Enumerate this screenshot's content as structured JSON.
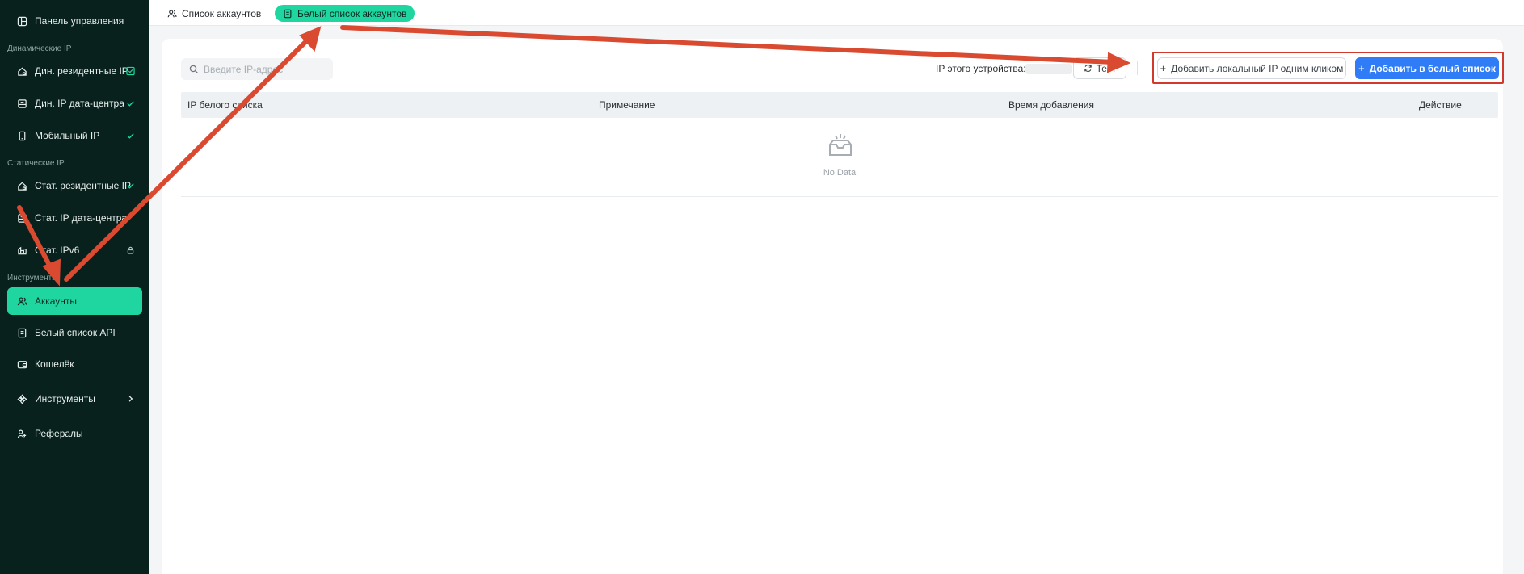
{
  "sidebar": {
    "items": [
      {
        "label": "Панель управления",
        "icon": "dashboard-icon"
      },
      {
        "label": "Дин. резидентные IP",
        "icon": "home-wifi-icon",
        "trail": "checkbox-check-icon"
      },
      {
        "label": "Дин. IP дата-центра",
        "icon": "datacenter-icon",
        "trail": "check-icon"
      },
      {
        "label": "Мобильный IP",
        "icon": "phone-icon",
        "trail": "check-icon"
      },
      {
        "label": "Стат. резидентные IP",
        "icon": "home-icon",
        "trail": "check-icon"
      },
      {
        "label": "Стат. IP дата-центра",
        "icon": "server-icon"
      },
      {
        "label": "Стат. IPv6",
        "icon": "ipv6-icon",
        "trail": "lock-icon"
      },
      {
        "label": "Аккаунты",
        "icon": "users-icon",
        "active": true
      },
      {
        "label": "Белый список API",
        "icon": "document-icon"
      },
      {
        "label": "Кошелёк",
        "icon": "wallet-icon"
      },
      {
        "label": "Инструменты",
        "icon": "tools-icon",
        "trail": "chevron-right-icon"
      },
      {
        "label": "Рефералы",
        "icon": "referral-icon"
      }
    ],
    "sections": {
      "dynamic": "Динамические IP",
      "static": "Статические IP",
      "tools": "Инструменты"
    }
  },
  "tabs": [
    {
      "label": "Список аккаунтов",
      "icon": "users-icon"
    },
    {
      "label": "Белый список аккаунтов",
      "icon": "document-icon",
      "active": true
    }
  ],
  "search": {
    "placeholder": "Введите IP-адрес"
  },
  "device_ip": {
    "label": "IP этого устройства:"
  },
  "buttons": {
    "test": "Тест",
    "add_local": "Добавить локальный IP одним кликом",
    "add_whitelist": "Добавить в белый список"
  },
  "table": {
    "columns": [
      "IP белого списка",
      "Примечание",
      "Время добавления",
      "Действие"
    ],
    "empty_text": "No Data"
  },
  "colors": {
    "sidebar_bg": "#08211d",
    "accent": "#1fd6a0",
    "primary": "#2f7cf6",
    "annotation": "#d0392b"
  }
}
